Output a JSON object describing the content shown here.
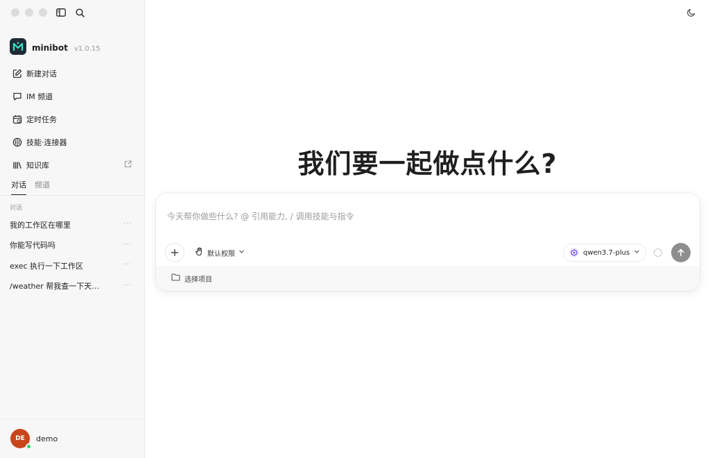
{
  "app": {
    "name": "minibot",
    "version": "v1.0.15"
  },
  "sidebar": {
    "nav": [
      {
        "label": "新建对话",
        "icon": "edit-icon"
      },
      {
        "label": "IM 频道",
        "icon": "chat-icon"
      },
      {
        "label": "定时任务",
        "icon": "calendar-clock-icon"
      },
      {
        "label": "技能·连接器",
        "icon": "brain-icon"
      },
      {
        "label": "知识库",
        "icon": "library-icon"
      }
    ],
    "tabs": [
      {
        "label": "对话",
        "active": true
      },
      {
        "label": "频道",
        "active": false
      }
    ],
    "section_label": "对话",
    "conversations": [
      {
        "title": "我的工作区在哪里",
        "more": "···"
      },
      {
        "title": "你能写代码吗",
        "more": "···"
      },
      {
        "title": "exec 执行一下工作区",
        "more": "···"
      },
      {
        "title": "/weather 帮我查一下天...",
        "more": "···"
      }
    ],
    "user": {
      "initials": "DE",
      "name": "demo",
      "status_color": "#2ecc71",
      "avatar_color": "#c9461c"
    }
  },
  "main": {
    "headline": "我们要一起做点什么?",
    "composer": {
      "placeholder": "今天帮你做些什么? @ 引用能力, / 调用技能与指令",
      "permission_label": "默认权限",
      "model_label": "qwen3.7-plus",
      "project_label": "选择项目"
    }
  },
  "colors": {
    "sidebar_bg": "#f7f7f8",
    "send_button": "#8e8e8e"
  }
}
